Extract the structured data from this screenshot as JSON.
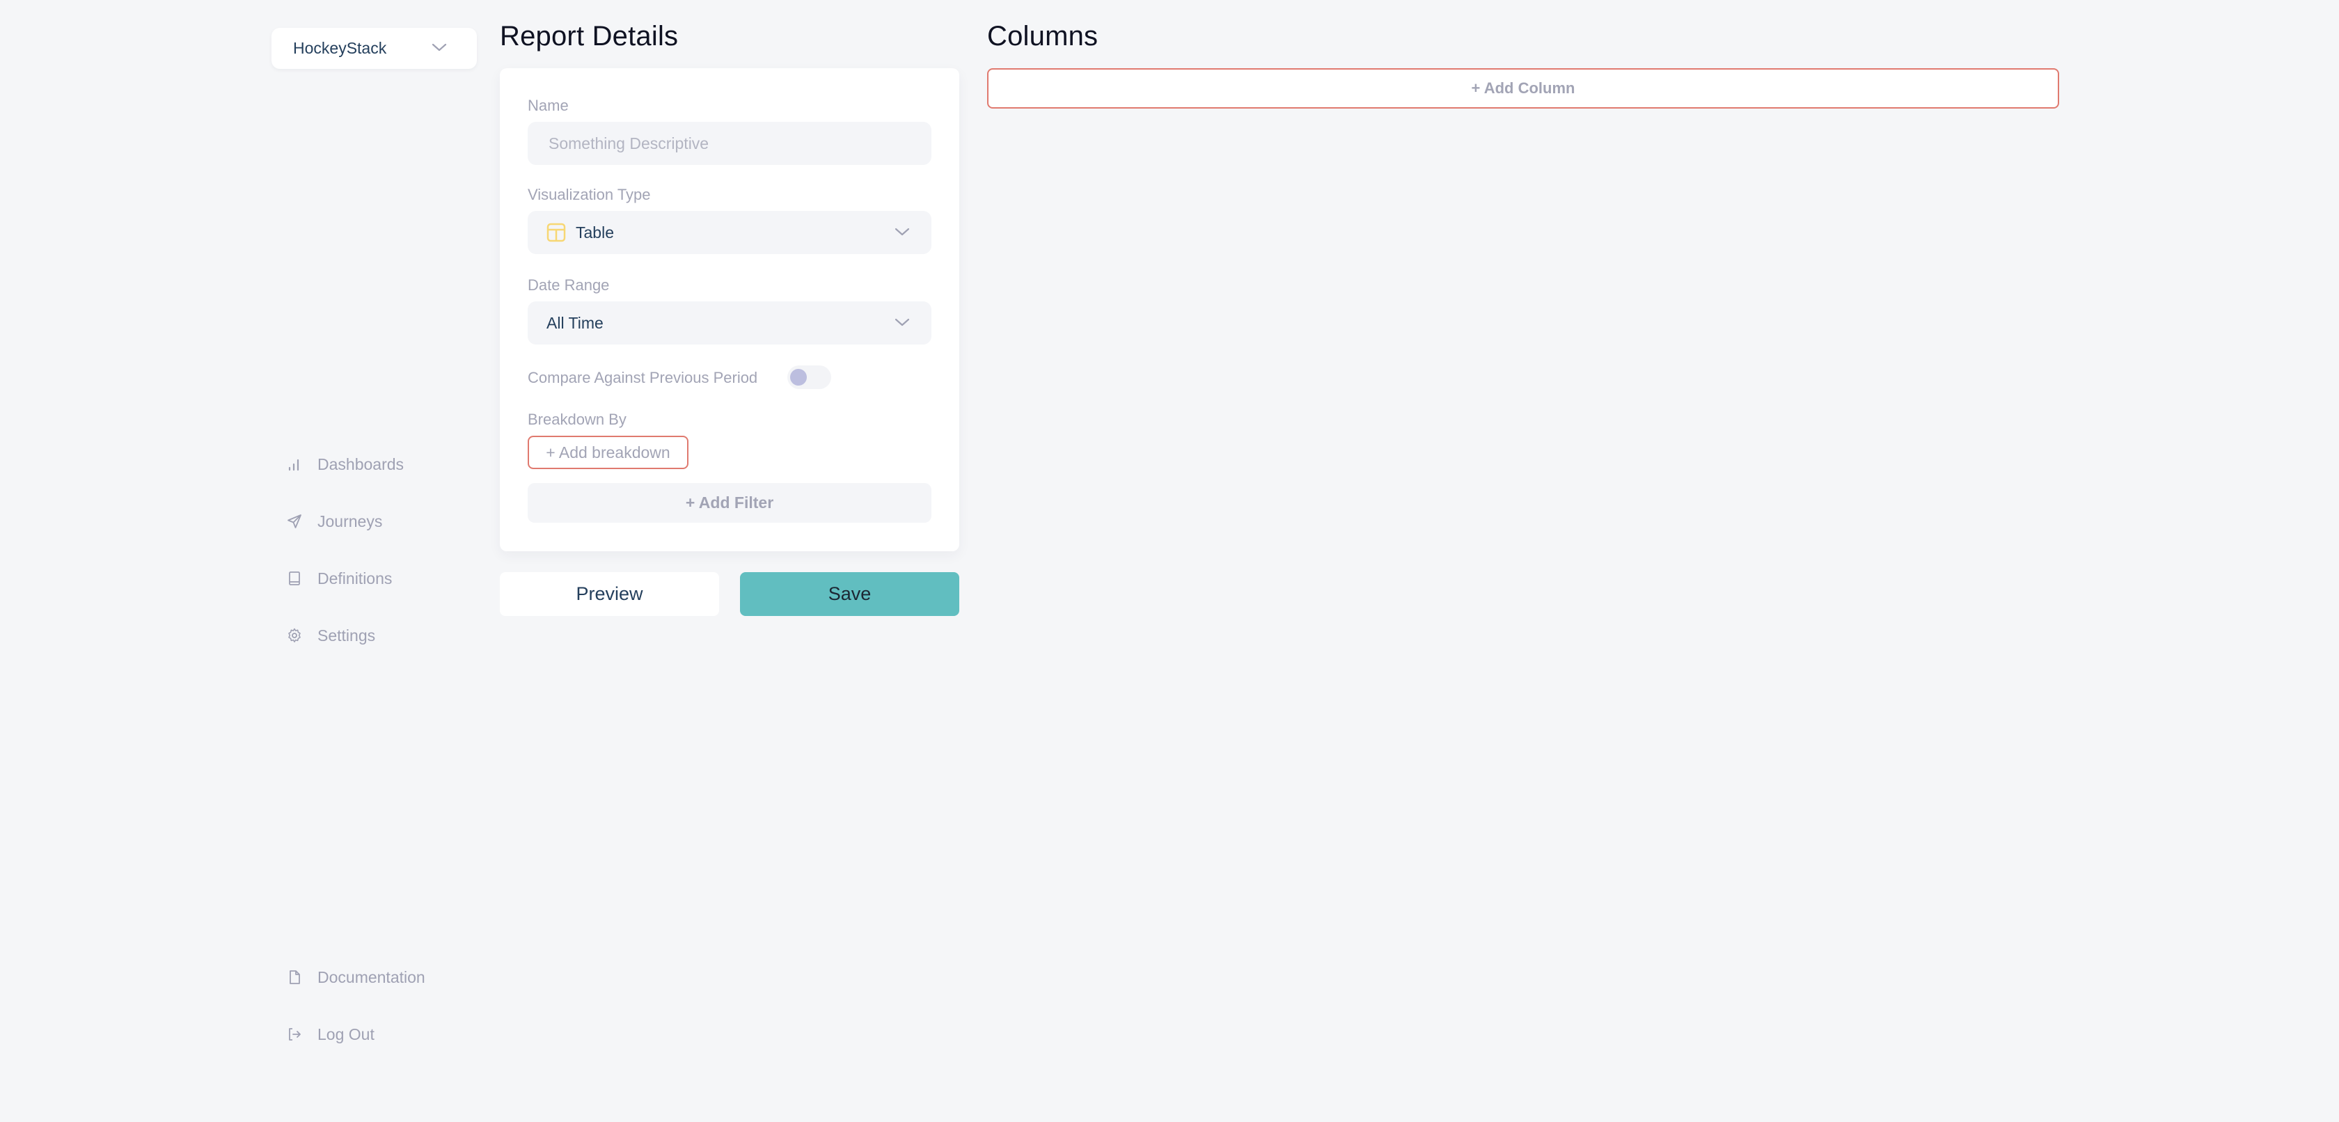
{
  "sidebar": {
    "workspace": {
      "label": "HockeyStack",
      "icon": "chevron-down-icon"
    },
    "nav": [
      {
        "label": "Dashboards",
        "icon": "bar-chart-icon"
      },
      {
        "label": "Journeys",
        "icon": "send-icon"
      },
      {
        "label": "Definitions",
        "icon": "book-icon"
      },
      {
        "label": "Settings",
        "icon": "gear-icon"
      }
    ],
    "footer": [
      {
        "label": "Documentation",
        "icon": "document-icon"
      },
      {
        "label": "Log Out",
        "icon": "logout-icon"
      }
    ]
  },
  "report_details": {
    "title": "Report Details",
    "name": {
      "label": "Name",
      "value": "",
      "placeholder": "Something Descriptive"
    },
    "visualization_type": {
      "label": "Visualization Type",
      "value": "Table",
      "icon": "table-icon"
    },
    "date_range": {
      "label": "Date Range",
      "value": "All Time"
    },
    "compare": {
      "label": "Compare Against Previous Period",
      "enabled": false
    },
    "breakdown": {
      "label": "Breakdown By",
      "add_label": "+ Add breakdown"
    },
    "filter": {
      "add_label": "+ Add Filter"
    },
    "preview_label": "Preview",
    "save_label": "Save"
  },
  "columns": {
    "title": "Columns",
    "add_label": "+ Add Column"
  },
  "colors": {
    "background": "#f5f6f8",
    "accent_save": "#61bec0",
    "accent_border": "#e07a6f",
    "table_icon": "#f7d774",
    "toggle_knob": "#bcbedf",
    "muted_text": "#a2a4b5",
    "dark_text": "#243f5c"
  }
}
